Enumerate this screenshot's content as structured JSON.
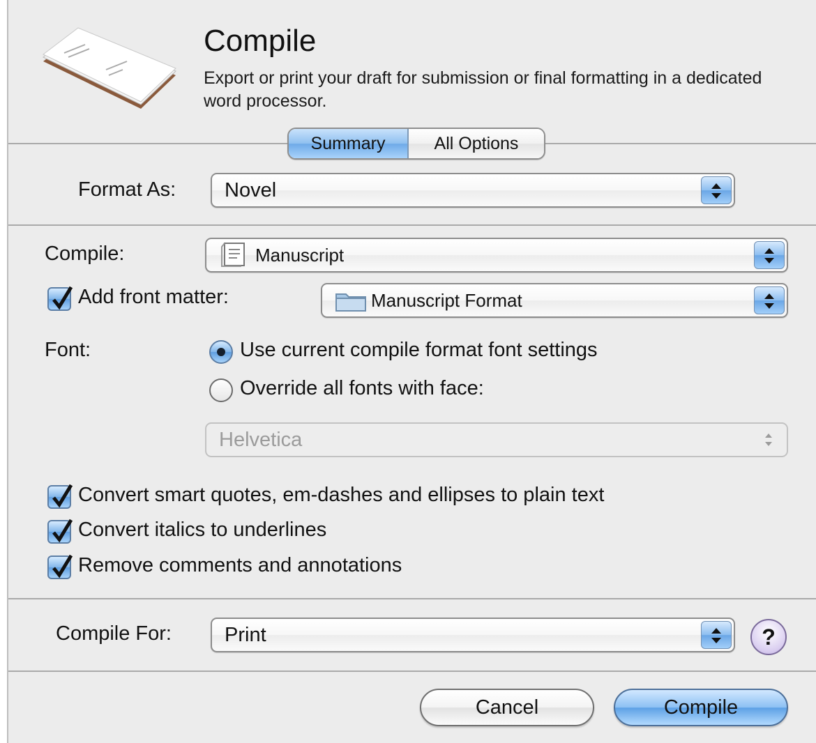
{
  "header": {
    "title": "Compile",
    "description": "Export or print your draft for submission or final formatting in a dedicated word processor."
  },
  "tabs": {
    "summary": "Summary",
    "all_options": "All Options",
    "active": "Summary"
  },
  "format_as": {
    "label": "Format As:",
    "value": "Novel"
  },
  "compile_group": {
    "label": "Compile:",
    "value": "Manuscript",
    "icon": "document-icon"
  },
  "front_matter": {
    "label": "Add front matter:",
    "checked": true,
    "value": "Manuscript Format",
    "icon": "folder-icon"
  },
  "font": {
    "label": "Font:",
    "option_current": "Use current compile format font settings",
    "option_override": "Override all fonts with face:",
    "selected": "current",
    "face_value": "Helvetica",
    "face_enabled": false
  },
  "options": [
    {
      "label": "Convert smart quotes, em-dashes and ellipses to plain text",
      "checked": true
    },
    {
      "label": "Convert italics to underlines",
      "checked": true
    },
    {
      "label": "Remove comments and annotations",
      "checked": true
    }
  ],
  "compile_for": {
    "label": "Compile For:",
    "value": "Print"
  },
  "help": {
    "glyph": "?"
  },
  "buttons": {
    "cancel": "Cancel",
    "compile": "Compile"
  },
  "colors": {
    "accent": "#6eaae8",
    "background": "#ececec",
    "help": "#d9cdf0"
  }
}
